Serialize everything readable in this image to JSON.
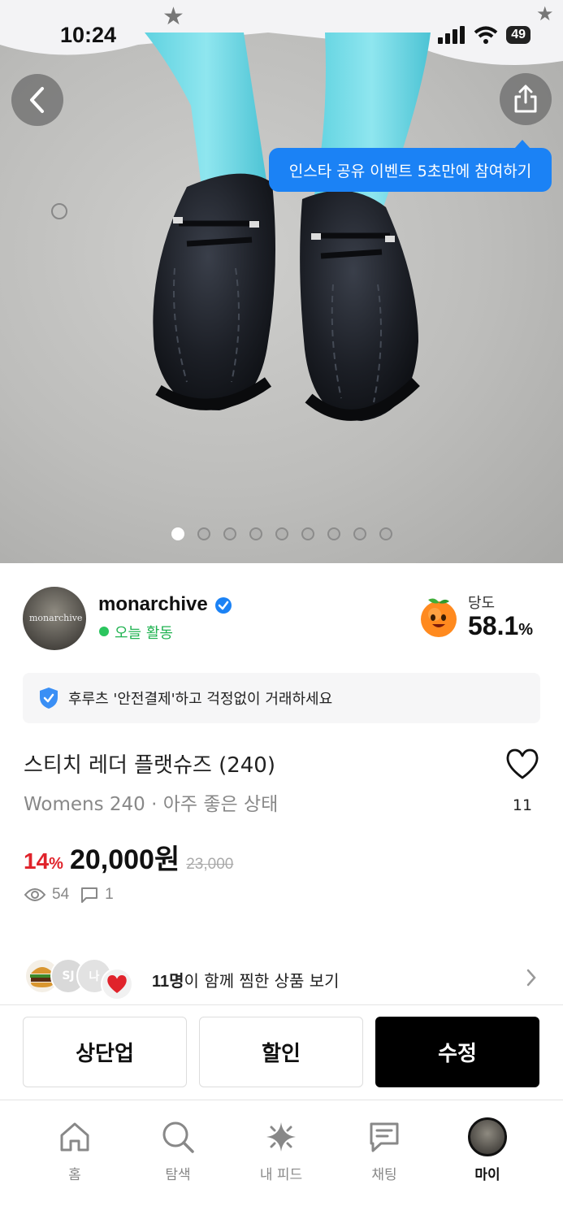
{
  "status_bar": {
    "time": "10:24",
    "battery": "49"
  },
  "tooltip": {
    "text": "인스타 공유 이벤트 5초만에 참여하기"
  },
  "gallery": {
    "image_count": 9,
    "active_index": 0
  },
  "seller": {
    "name": "monarchive",
    "avatar_text": "monarchive",
    "activity": "오늘 활동",
    "dangdo_label": "당도",
    "dangdo_value": "58.1",
    "dangdo_unit": "%"
  },
  "safe_payment": {
    "text": "후루츠 '안전결제'하고 걱정없이 거래하세요"
  },
  "product": {
    "title": "스티치 레더 플랫슈즈 (240)",
    "subtitle": "Womens 240 · 아주 좋은 상태",
    "likes": "11",
    "discount": "14",
    "discount_unit": "%",
    "price": "20,000원",
    "original_price": "23,000",
    "views": "54",
    "comments": "1"
  },
  "wishlist": {
    "avatars": [
      "SJ",
      "나"
    ],
    "count_text": "11명",
    "rest_text": "이 함께 찜한 상품 보기"
  },
  "actions": {
    "bump": "상단업",
    "discount": "할인",
    "edit": "수정"
  },
  "tabbar": {
    "home": "홈",
    "explore": "탐색",
    "feed": "내 피드",
    "chat": "채팅",
    "my": "마이"
  },
  "colors": {
    "accent_blue": "#1b82f5",
    "discount_red": "#e0232b",
    "active_green": "#2bc55e"
  }
}
